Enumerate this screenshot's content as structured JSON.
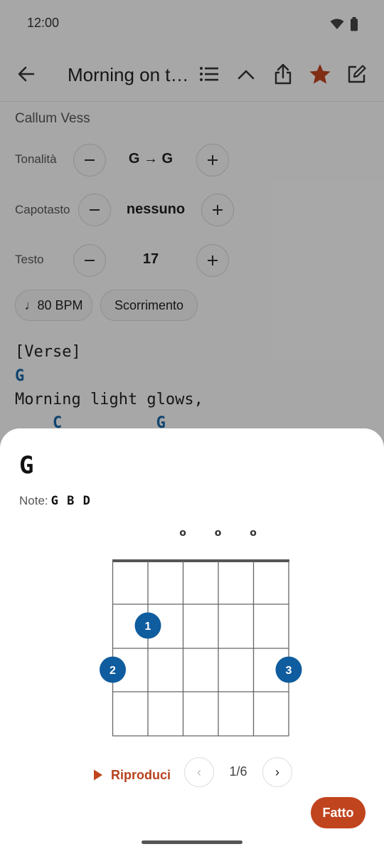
{
  "status": {
    "time": "12:00"
  },
  "toolbar": {
    "title": "Morning on the Hill",
    "icons": [
      "back-arrow-icon",
      "list-icon",
      "chevron-up-icon",
      "share-icon",
      "star-icon",
      "edit-icon"
    ],
    "star_color": "#c0441e"
  },
  "song": {
    "artist": "Callum Vess",
    "key": {
      "label": "Tonalità",
      "value": "G → G"
    },
    "capo": {
      "label": "Capotasto",
      "value": "nessuno"
    },
    "text": {
      "label": "Testo",
      "value": "17"
    },
    "bpm_pill": "♩80 BPM",
    "scroll_pill": "Scorrimento",
    "lyrics": {
      "section": "[Verse]",
      "chord_line_1": "G",
      "line_1": "Morning light glows,",
      "chord_line_2": "    C          G"
    }
  },
  "sheet": {
    "chord_name": "G",
    "notes_label": "Note:",
    "notes": "G B D",
    "open_strings": [
      "o",
      "o",
      "o"
    ],
    "fingers": [
      "1",
      "2",
      "3"
    ],
    "play_label": "Riproduci",
    "prev": "‹",
    "next": "›",
    "page": "1/6",
    "done": "Fatto",
    "accent": "#c0441e",
    "finger_color": "#0f5c9e"
  }
}
